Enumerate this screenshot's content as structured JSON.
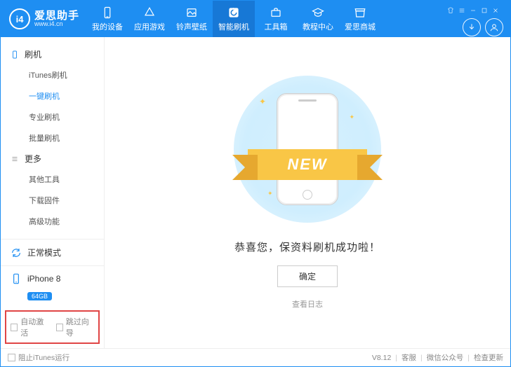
{
  "app": {
    "name": "爱思助手",
    "url": "www.i4.cn",
    "logo_text": "i4"
  },
  "nav": {
    "items": [
      {
        "id": "device",
        "label": "我的设备"
      },
      {
        "id": "apps",
        "label": "应用游戏"
      },
      {
        "id": "ringtone",
        "label": "铃声壁纸"
      },
      {
        "id": "flash",
        "label": "智能刷机"
      },
      {
        "id": "toolbox",
        "label": "工具箱"
      },
      {
        "id": "tutorial",
        "label": "教程中心"
      },
      {
        "id": "store",
        "label": "爱思商城"
      }
    ]
  },
  "sidebar": {
    "groups": [
      {
        "id": "flash",
        "label": "刷机",
        "items": [
          {
            "id": "itunes",
            "label": "iTunes刷机"
          },
          {
            "id": "oneclick",
            "label": "一键刷机",
            "active": true
          },
          {
            "id": "pro",
            "label": "专业刷机"
          },
          {
            "id": "batch",
            "label": "批量刷机"
          }
        ]
      },
      {
        "id": "more",
        "label": "更多",
        "items": [
          {
            "id": "other",
            "label": "其他工具"
          },
          {
            "id": "download",
            "label": "下载固件"
          },
          {
            "id": "advanced",
            "label": "高级功能"
          }
        ]
      }
    ],
    "mode_label": "正常模式",
    "device_name": "iPhone 8",
    "device_badge": "64GB",
    "checkboxes": [
      {
        "id": "auto_activate",
        "label": "自动激活"
      },
      {
        "id": "skip_guide",
        "label": "跳过向导"
      }
    ]
  },
  "main": {
    "ribbon": "NEW",
    "message": "恭喜您，保资料刷机成功啦！",
    "ok_label": "确定",
    "log_label": "查看日志"
  },
  "footer": {
    "block_itunes": "阻止iTunes运行",
    "version": "V8.12",
    "support": "客服",
    "wechat": "微信公众号",
    "update": "检查更新"
  }
}
